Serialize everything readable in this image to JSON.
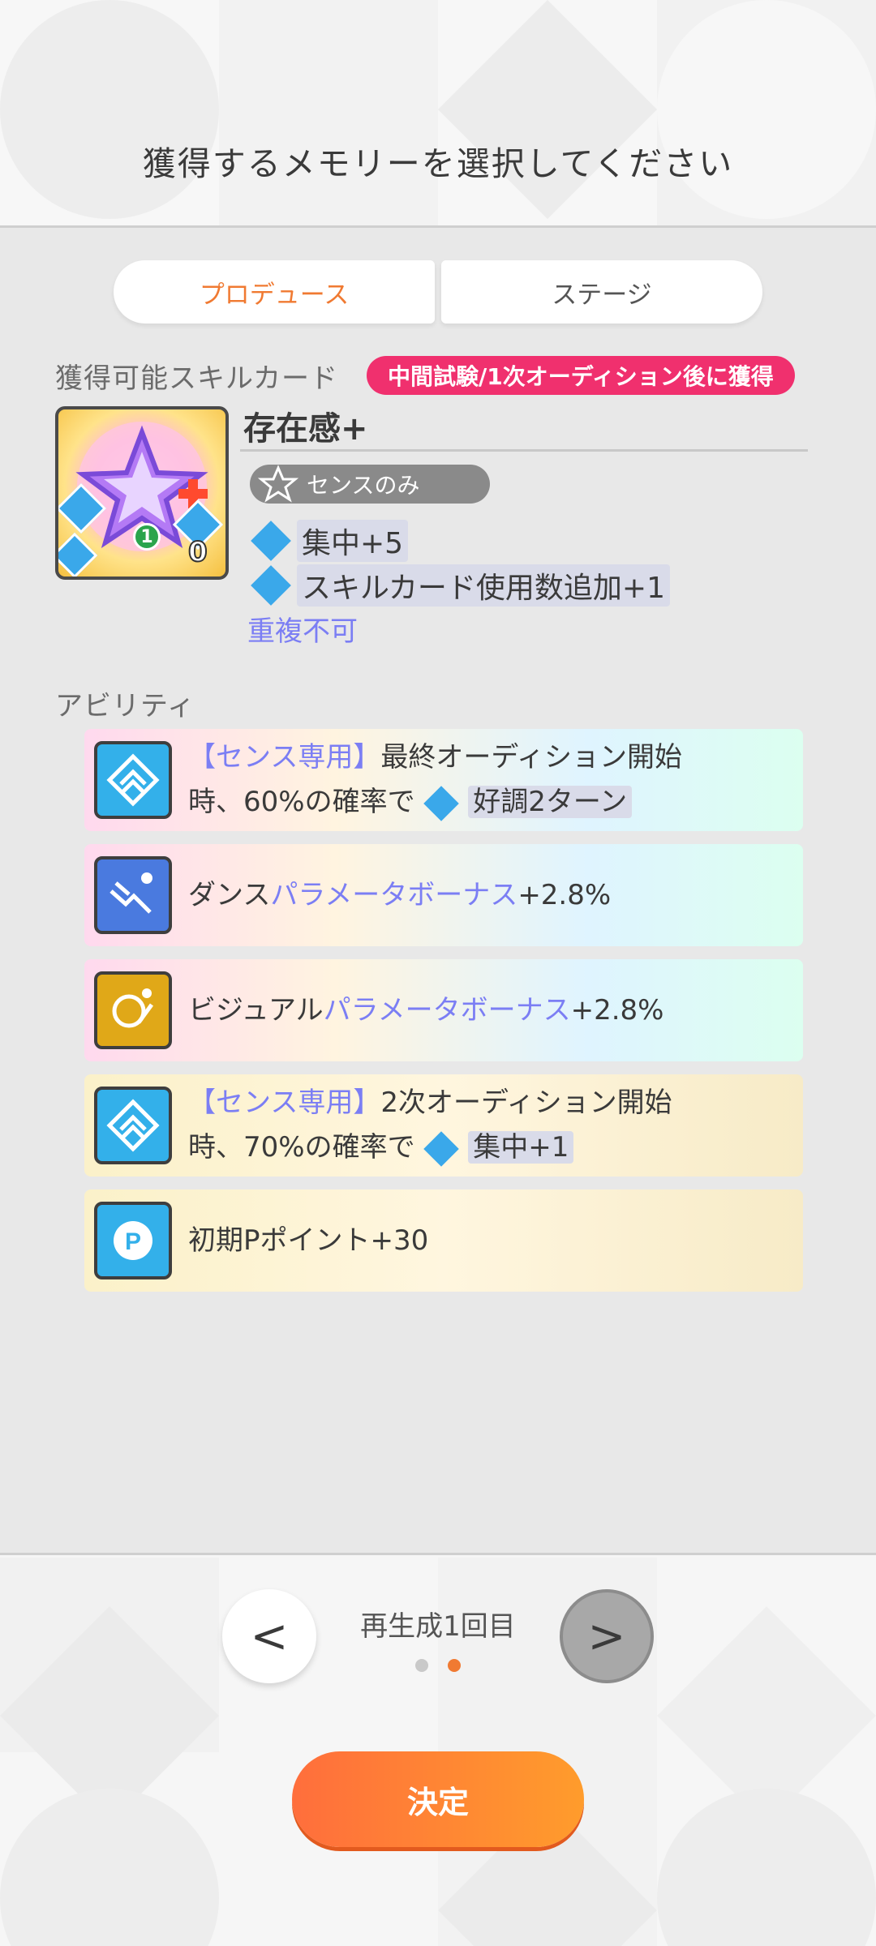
{
  "header": {
    "title": "獲得するメモリーを選択してください"
  },
  "tabs": [
    {
      "label": "プロデュース"
    },
    {
      "label": "ステージ"
    }
  ],
  "skill_section": {
    "label": "獲得可能スキルカード",
    "condition_badge": "中間試験/1次オーディション後に獲得",
    "card": {
      "name": "存在感+",
      "type_badge": "センスのみ",
      "effects": [
        {
          "text": "集中+5",
          "icon": "focus-icon"
        },
        {
          "text": "スキルカード使用数追加+1",
          "icon": "plus-one-icon"
        }
      ],
      "note": "重複不可",
      "cost": "1",
      "counter": "0"
    }
  },
  "ability_section": {
    "label": "アビリティ",
    "items": [
      {
        "prefix": "【センス専用】",
        "line1": "最終オーディション開始",
        "line2a": "時、60%の確率で",
        "chip": "好調2ターン",
        "style": "rainbow",
        "icon": "sense-chevron-icon"
      },
      {
        "plain": "ダンス",
        "hl": "パラメータボーナス",
        "suffix": "+2.8%",
        "style": "rainbow",
        "icon": "dance-icon"
      },
      {
        "plain": "ビジュアル",
        "hl": "パラメータボーナス",
        "suffix": "+2.8%",
        "style": "rainbow",
        "icon": "visual-icon"
      },
      {
        "prefix": "【センス専用】",
        "line1": "2次オーディション開始",
        "line2a": "時、70%の確率で",
        "chip": "集中+1",
        "style": "gold",
        "icon": "sense-chevron-icon"
      },
      {
        "plain": "初期Pポイント+30",
        "style": "gold",
        "icon": "p-point-icon"
      }
    ]
  },
  "pager": {
    "label": "再生成1回目",
    "prev": "<",
    "next": ">"
  },
  "confirm_button": "決定",
  "colors": {
    "accent": "#f07a32",
    "pink": "#f0306e",
    "link": "#7b7ef4",
    "button": "#ff7a32"
  }
}
